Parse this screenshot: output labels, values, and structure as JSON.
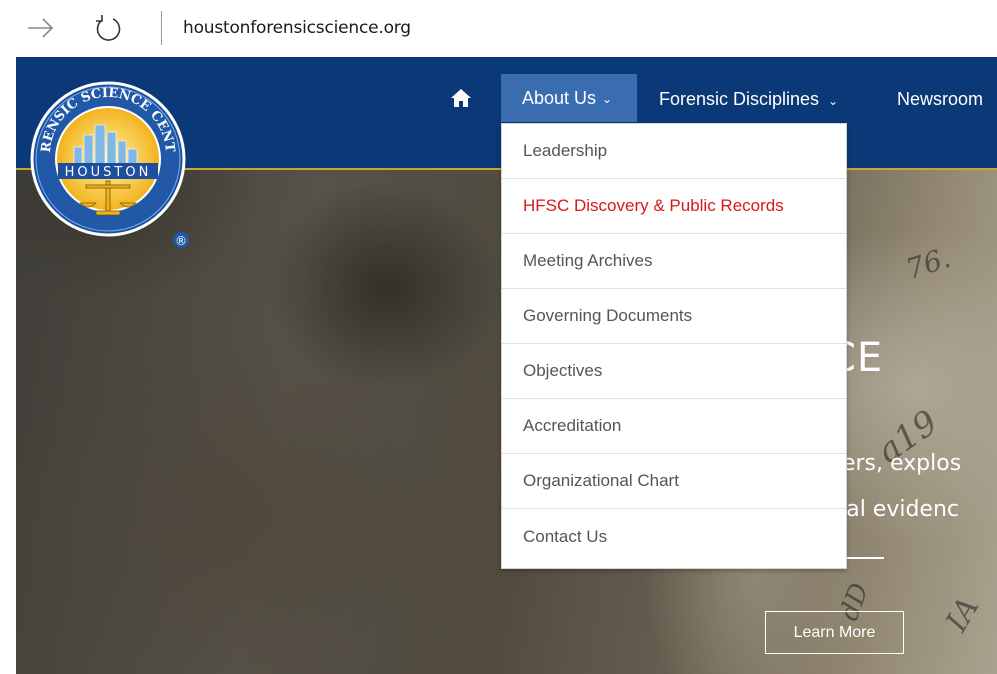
{
  "browser": {
    "url": "houstonforensicscience.org"
  },
  "header": {
    "logo": {
      "top_text": "FORENSIC SCIENCE CENTER",
      "city_text": "HOUSTON",
      "registered": "®"
    },
    "nav": {
      "about_label": "About Us",
      "forensic_label": "Forensic Disciplines",
      "newsroom_label": "Newsroom"
    }
  },
  "dropdown": {
    "items": [
      {
        "label": "Leadership"
      },
      {
        "label": "HFSC Discovery & Public Records"
      },
      {
        "label": "Meeting Archives"
      },
      {
        "label": "Governing Documents"
      },
      {
        "label": "Objectives"
      },
      {
        "label": "Accreditation"
      },
      {
        "label": "Organizational Chart"
      },
      {
        "label": "Contact Us"
      }
    ],
    "active_color": "#d7191a"
  },
  "hero": {
    "title": "CE",
    "line1": "bers, explos",
    "line2": "ical evidenc",
    "button_label": "Learn More"
  },
  "colors": {
    "header_bg": "#0b3876",
    "nav_active_bg": "#3a6cb0",
    "header_border": "#c9a534"
  },
  "icons": {
    "back": "arrow-right-icon",
    "reload": "reload-icon",
    "home": "home-icon",
    "chevron": "chevron-down-icon"
  }
}
